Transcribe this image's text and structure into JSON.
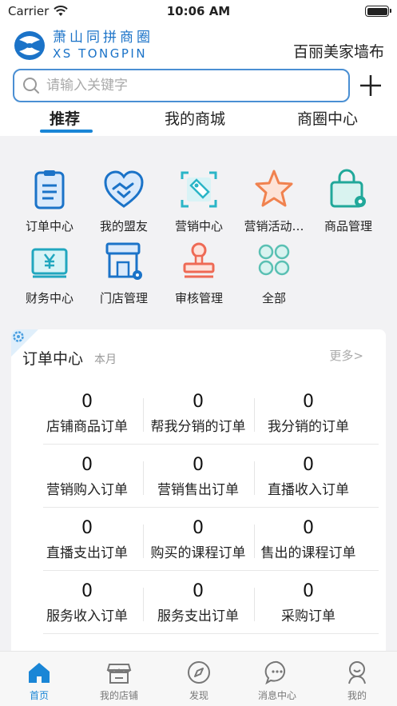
{
  "status_bar": {
    "carrier": "Carrier",
    "time": "10:06 AM"
  },
  "header": {
    "logo_cn": "萧山同拼商圈",
    "logo_en": "XS TONGPIN",
    "shop_name": "百丽美家墙布",
    "search_placeholder": "请输入关键字"
  },
  "top_tabs": [
    {
      "label": "推荐",
      "active": true
    },
    {
      "label": "我的商城",
      "active": false
    },
    {
      "label": "商圈中心",
      "active": false
    }
  ],
  "menu": [
    {
      "label": "订单中心",
      "icon": "order-center-icon"
    },
    {
      "label": "我的盟友",
      "icon": "ally-heart-icon"
    },
    {
      "label": "营销中心",
      "icon": "marketing-tag-icon"
    },
    {
      "label": "营销活动…",
      "icon": "star-icon"
    },
    {
      "label": "商品管理",
      "icon": "product-bag-icon"
    },
    {
      "label": "财务中心",
      "icon": "finance-yen-icon"
    },
    {
      "label": "门店管理",
      "icon": "store-icon"
    },
    {
      "label": "审核管理",
      "icon": "stamp-icon"
    },
    {
      "label": "全部",
      "icon": "all-grid-icon"
    }
  ],
  "orders": {
    "title": "订单中心",
    "period": "本月",
    "more": "更多>",
    "stats": [
      {
        "value": "0",
        "label": "店铺商品订单"
      },
      {
        "value": "0",
        "label": "帮我分销的订单"
      },
      {
        "value": "0",
        "label": "我分销的订单"
      },
      {
        "value": "0",
        "label": "营销购入订单"
      },
      {
        "value": "0",
        "label": "营销售出订单"
      },
      {
        "value": "0",
        "label": "直播收入订单"
      },
      {
        "value": "0",
        "label": "直播支出订单"
      },
      {
        "value": "0",
        "label": "购买的课程订单"
      },
      {
        "value": "0",
        "label": "售出的课程订单"
      },
      {
        "value": "0",
        "label": "服务收入订单"
      },
      {
        "value": "0",
        "label": "服务支出订单"
      },
      {
        "value": "0",
        "label": "采购订单"
      }
    ]
  },
  "bottom_tabs": [
    {
      "label": "首页",
      "icon": "home-icon",
      "active": true
    },
    {
      "label": "我的店铺",
      "icon": "shop-icon",
      "active": false
    },
    {
      "label": "发现",
      "icon": "compass-icon",
      "active": false
    },
    {
      "label": "消息中心",
      "icon": "message-icon",
      "active": false
    },
    {
      "label": "我的",
      "icon": "profile-icon",
      "active": false
    }
  ],
  "colors": {
    "accent": "#1a86d6",
    "brand_logo": "#1b73c8",
    "search_border": "#4a8fd3"
  }
}
